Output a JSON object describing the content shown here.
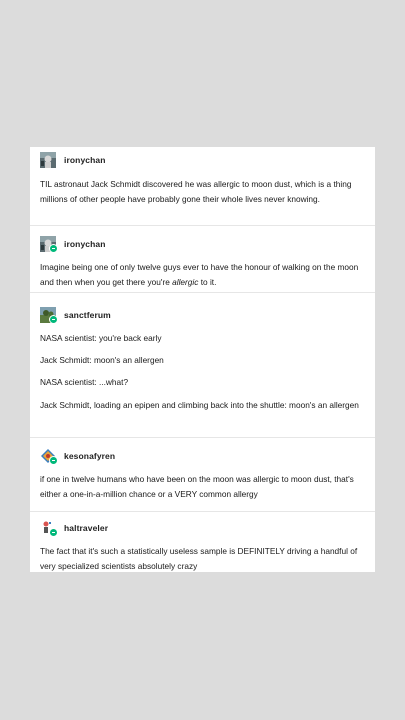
{
  "posts": [
    {
      "username": "ironychan",
      "avatar_icon": "astronaut-avatar-icon",
      "paragraphs": [
        "TIL astronaut Jack Schmidt discovered he was allergic to moon dust, which is a thing millions of other people have probably gone their whole lives never knowing."
      ]
    },
    {
      "username": "ironychan",
      "avatar_icon": "astronaut-avatar-icon",
      "paragraphs": [
        "Imagine being one of only twelve guys ever to have the honour of walking on the moon and then when you get there you're allergic to it."
      ],
      "emphasis_word": "allergic"
    },
    {
      "username": "sanctferum",
      "avatar_icon": "landscape-avatar-icon",
      "paragraphs": [
        "NASA scientist: you're back early",
        "Jack Schmidt: moon's an allergen",
        "NASA scientist: ...what?",
        "Jack Schmidt, loading an epipen and climbing back into the shuttle: moon's an allergen"
      ]
    },
    {
      "username": "kesonafyren",
      "avatar_icon": "diamond-avatar-icon",
      "paragraphs": [
        "if one in twelve humans who have been on the moon was allergic to moon dust, that's either a one-in-a-million chance or a VERY common allergy"
      ]
    },
    {
      "username": "haltraveler",
      "avatar_icon": "figure-avatar-icon",
      "paragraphs": [
        "The fact that it's such a statistically useless sample is DEFINITELY driving a handful of very specialized scientists absolutely crazy"
      ]
    }
  ],
  "colors": {
    "background": "#dcdcdc",
    "card": "#ffffff",
    "badge": "#00b87a",
    "text": "#1a1a1a"
  }
}
